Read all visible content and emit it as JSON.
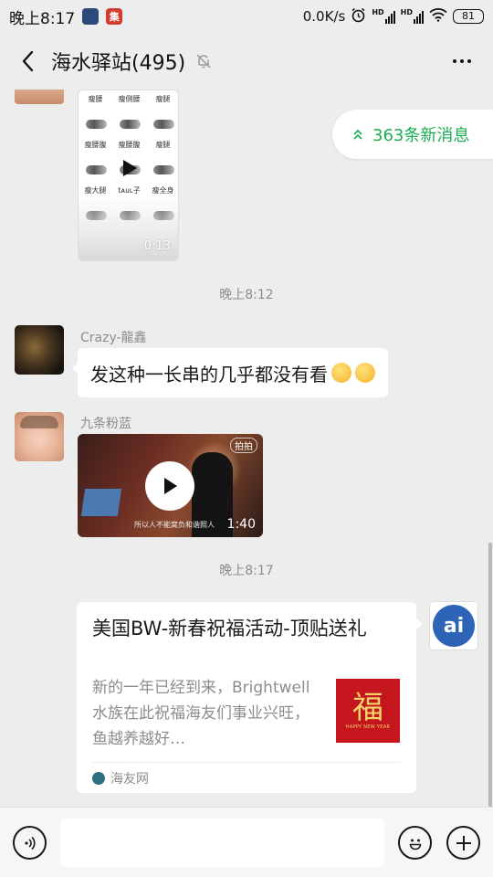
{
  "status_bar": {
    "time": "晚上8:17",
    "network_speed": "0.0K/s",
    "signal_label_1": "HD",
    "signal_label_2": "HD",
    "battery": "81",
    "app_icon_1": "",
    "app_icon_2": "集"
  },
  "nav": {
    "title": "海水驿站(495)",
    "icons": {
      "back": "chevron-left",
      "mute": "bell-muted",
      "more": "more-horizontal"
    }
  },
  "new_messages": {
    "label": "363条新消息",
    "icon": "double-chevron-up",
    "color": "#19ad50"
  },
  "video1": {
    "duration": "0:13",
    "labels": [
      "瘦腰",
      "瘦侧腰",
      "瘦腿",
      "瘦腰腹",
      "瘦腰腹",
      "瘦腿",
      "瘦大腿",
      "tᴀᴜʟ子",
      "瘦全身"
    ]
  },
  "timestamps": [
    "晚上8:12",
    "晚上8:17"
  ],
  "messages": [
    {
      "sender": "Crazy-龍鑫",
      "text": "发这种一长串的几乎都没有看",
      "emoji": "thinking-face x2"
    },
    {
      "sender": "九条粉蓝",
      "video_duration": "1:40",
      "video_caption": "所以人不能窝负和谐照人",
      "video_badge": "拍拍"
    }
  ],
  "link_card": {
    "title": "美国BW-新春祝福活动-顶贴送礼",
    "description": "新的一年已经到来，Brightwell水族在此祝福海友们事业兴旺，鱼越养越好…",
    "thumb_char": "福",
    "thumb_sub": "HAPPY NEW YEAR",
    "source": "海友网",
    "sender_avatar_text": "ai"
  },
  "input": {
    "placeholder": "",
    "value": ""
  },
  "colors": {
    "background": "#ededed",
    "accent": "#19ad50",
    "bubble": "#ffffff"
  }
}
